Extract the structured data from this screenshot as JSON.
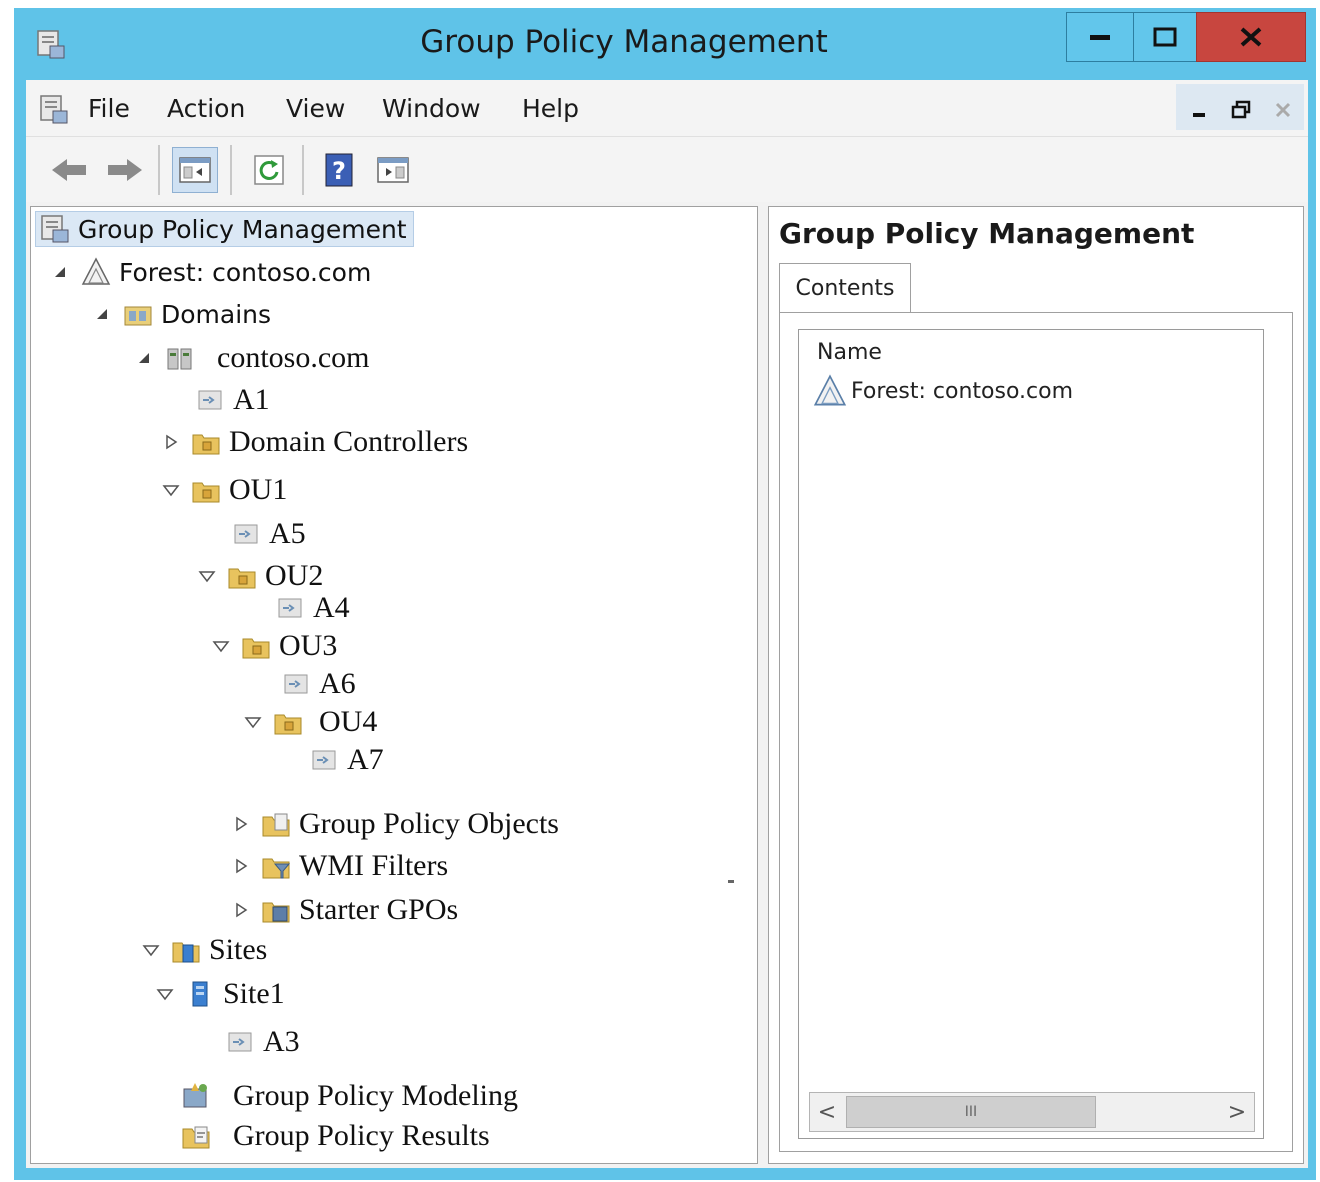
{
  "window": {
    "title": "Group Policy Management",
    "accent_color": "#5fc3e8",
    "close_color": "#c8463f",
    "controls": {
      "minimize": "minimize-icon",
      "maximize": "maximize-icon",
      "close": "close-icon"
    }
  },
  "menu": {
    "items": [
      "File",
      "Action",
      "View",
      "Window",
      "Help"
    ],
    "mdi_controls": [
      "minimize-icon",
      "restore-icon",
      "close-icon"
    ]
  },
  "toolbar": {
    "buttons": [
      "back-arrow-icon",
      "forward-arrow-icon",
      "show-hide-console-tree-icon",
      "refresh-icon",
      "help-icon",
      "show-hide-action-pane-icon"
    ]
  },
  "tree": {
    "root": "Group Policy Management",
    "forest": "Forest: contoso.com",
    "domains": "Domains",
    "domain": "contoso.com",
    "a1": "A1",
    "domain_controllers": "Domain Controllers",
    "ou1": "OU1",
    "a5": "A5",
    "ou2": "OU2",
    "a4": "A4",
    "ou3": "OU3",
    "a6": "A6",
    "ou4": "OU4",
    "a7": "A7",
    "gpo": "Group Policy Objects",
    "wmi": "WMI Filters",
    "starter": "Starter GPOs",
    "sites": "Sites",
    "site1": "Site1",
    "a3": "A3",
    "modeling": "Group Policy Modeling",
    "results": "Group Policy Results"
  },
  "details": {
    "title": "Group Policy Management",
    "tab": "Contents",
    "column": "Name",
    "row": "Forest: contoso.com",
    "scroll_thumb_glyph": "III",
    "scroll_left": "<",
    "scroll_right": ">"
  }
}
